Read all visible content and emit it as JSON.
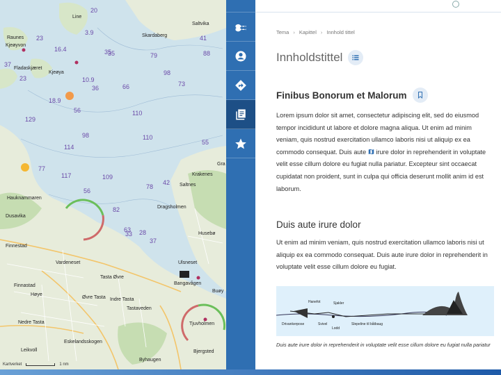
{
  "map": {
    "place_names": [
      "Line",
      "Saltvika",
      "Skardaberg",
      "Raunes",
      "Kjeøyvon",
      "Fladaskjæret",
      "Kjeøya",
      "Hauknammaren",
      "Dusavika",
      "Finnestad",
      "Dragsholmen",
      "Krakenes",
      "Saltnes",
      "Husebø",
      "Vardeneset",
      "Tasta Øvre",
      "Bangavågen",
      "Ulsneset",
      "Finnastad",
      "Høye",
      "Øvre Tasta",
      "Indre Tasta",
      "Tastaveden",
      "Buøy",
      "Nedre Tasta",
      "Tjuvholmen",
      "Eskelandsskogen",
      "Leikvoll",
      "Byhaugen",
      "Bjergsted",
      "Gra"
    ],
    "depths": [
      "20",
      "3.9",
      "35",
      "23",
      "16.4",
      "35",
      "79",
      "41",
      "88",
      "37",
      "10.9",
      "98",
      "23",
      "36",
      "66",
      "73",
      "18.9",
      "56",
      "110",
      "129",
      "98",
      "110",
      "55",
      "114",
      "77",
      "117",
      "109",
      "78",
      "42",
      "56",
      "82",
      "33",
      "28",
      "63",
      "37"
    ],
    "attribution": "Kartverket",
    "scale_label": "1 nm"
  },
  "rail": {
    "buttons": [
      {
        "icon": "waves-icon",
        "name": "rail-waves-button"
      },
      {
        "icon": "user-icon",
        "name": "rail-profile-button"
      },
      {
        "icon": "directions-icon",
        "name": "rail-route-button"
      },
      {
        "icon": "library-icon",
        "name": "rail-content-button",
        "active": true
      },
      {
        "icon": "star-icon",
        "name": "rail-favorites-button"
      }
    ]
  },
  "content": {
    "breadcrumb": [
      "Tema",
      "Kapittel",
      "Innhold tittel"
    ],
    "title": "Innholdstittel",
    "section1": {
      "heading": "Finibus Bonorum et Malorum",
      "text_before_icon": "Lorem ipsum dolor sit amet, consectetur adipiscing elit, sed do eiusmod tempor incididunt ut labore et dolore magna aliqua. Ut enim ad minim veniam, quis nostrud exercitation ullamco laboris nisi ut aliquip ex ea commodo consequat. Duis aute ",
      "text_after_icon": " irure dolor in reprehenderit in voluptate velit esse cillum dolore eu fugiat nulla pariatur. Excepteur sint occaecat cupidatat non proident, sunt in culpa qui officia deserunt mollit anim id est laborum."
    },
    "section2": {
      "heading": "Duis aute irure dolor",
      "text": "Ut enim ad minim veniam, quis nostrud exercitation ullamco laboris nisi ut aliquip ex ea commodo consequat. Duis aute irure dolor in reprehenderit in voluptate velit esse cillum dolore eu fugiat."
    },
    "figure": {
      "labels": [
        "Hanefot",
        "Sjakler",
        "Drivankerpose",
        "Svivel",
        "Lodd",
        "Slepeline til båtbaug"
      ]
    },
    "caption": "Duis aute irure dolor in reprehenderit in voluptate velit esse cillum dolore eu fugiat nulla pariatur"
  },
  "colors": {
    "rail": "#2f6fb2",
    "rail_active": "#1d4f86",
    "sea": "#cfe3ec",
    "land": "#e7ecdb",
    "depth_text": "#6b4aa8"
  }
}
